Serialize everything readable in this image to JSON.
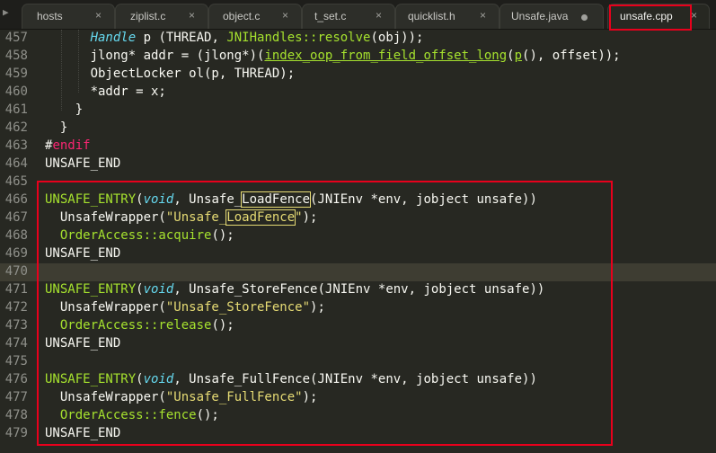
{
  "tabs": [
    {
      "label": "hosts",
      "marker": "×"
    },
    {
      "label": "ziplist.c",
      "marker": "×"
    },
    {
      "label": "object.c",
      "marker": "×"
    },
    {
      "label": "t_set.c",
      "marker": "×"
    },
    {
      "label": "quicklist.h",
      "marker": "×"
    },
    {
      "label": "Unsafe.java",
      "marker": "dot"
    },
    {
      "label": "unsafe.cpp",
      "marker": "×"
    }
  ],
  "active_tab": "unsafe.cpp",
  "line_numbers": [
    "457",
    "458",
    "459",
    "460",
    "461",
    "462",
    "463",
    "464",
    "465",
    "466",
    "467",
    "468",
    "469",
    "470",
    "471",
    "472",
    "473",
    "474",
    "475",
    "476",
    "477",
    "478",
    "479"
  ],
  "code": {
    "l457": {
      "a": "      ",
      "kw": "Handle",
      "b": " p (THREAD, ",
      "fn": "JNIHandles::resolve",
      "c": "(obj));"
    },
    "l458": {
      "a": "      jlong* addr = (jlong*)(",
      "fn": "index_oop_from_field_offset_long",
      "b": "(",
      "fn2": "p",
      "c": "(), offset));"
    },
    "l459": {
      "a": "      ObjectLocker ol(p, THREAD);"
    },
    "l460": {
      "a": "      *addr = x;"
    },
    "l461": {
      "a": "    }"
    },
    "l462": {
      "a": "  }"
    },
    "l463": {
      "hash": "#",
      "kw": "endif"
    },
    "l464": {
      "a": "UNSAFE_END"
    },
    "l466": {
      "fn": "UNSAFE_ENTRY",
      "p1": "(",
      "kw": "void",
      "p2": ", Unsafe_",
      "found": "LoadFence",
      "p3": "(JNIEnv *env, jobject unsafe))"
    },
    "l467": {
      "a": "  UnsafeWrapper(",
      "str1": "\"Unsafe_",
      "found": "LoadFence",
      "str2": "\"",
      "b": ");"
    },
    "l468": {
      "fn": "  OrderAccess::acquire",
      "b": "();"
    },
    "l469": {
      "a": "UNSAFE_END"
    },
    "l471": {
      "fn": "UNSAFE_ENTRY",
      "p1": "(",
      "kw": "void",
      "p2": ", Unsafe_StoreFence(JNIEnv *env, jobject unsafe))"
    },
    "l472": {
      "a": "  UnsafeWrapper(",
      "str": "\"Unsafe_StoreFence\"",
      "b": ");"
    },
    "l473": {
      "fn": "  OrderAccess::release",
      "b": "();"
    },
    "l474": {
      "a": "UNSAFE_END"
    },
    "l476": {
      "fn": "UNSAFE_ENTRY",
      "p1": "(",
      "kw": "void",
      "p2": ", Unsafe_FullFence(JNIEnv *env, jobject unsafe))"
    },
    "l477": {
      "a": "  UnsafeWrapper(",
      "str": "\"Unsafe_FullFence\"",
      "b": ");"
    },
    "l478": {
      "fn": "  OrderAccess::fence",
      "b": "();"
    },
    "l479": {
      "a": "UNSAFE_END"
    }
  }
}
